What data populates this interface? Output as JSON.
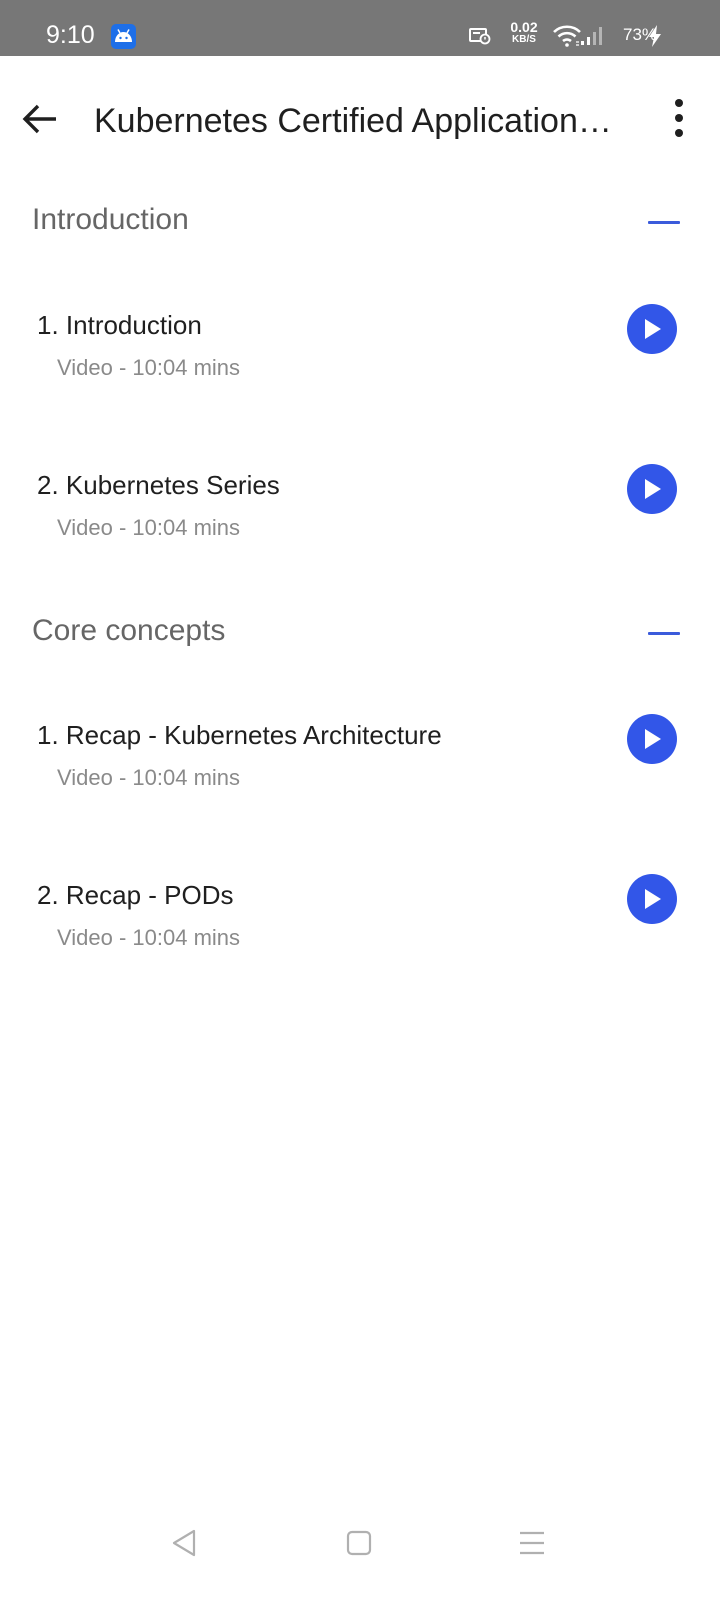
{
  "status_bar": {
    "time": "9:10",
    "net_speed_value": "0.02",
    "net_speed_unit": "KB/S",
    "battery": "73%"
  },
  "app_bar": {
    "title": "Kubernetes Certified Application Developer"
  },
  "sections": [
    {
      "title": "Introduction",
      "lessons": [
        {
          "title": "1. Introduction",
          "meta": "Video - 10:04 mins"
        },
        {
          "title": "2. Kubernetes Series",
          "meta": "Video - 10:04 mins"
        }
      ]
    },
    {
      "title": "Core concepts",
      "lessons": [
        {
          "title": "1. Recap - Kubernetes Architecture",
          "meta": "Video - 10:04 mins"
        },
        {
          "title": "2. Recap - PODs",
          "meta": "Video - 10:04 mins"
        }
      ]
    }
  ],
  "colors": {
    "accent": "#3256e8",
    "status_bar": "#777777",
    "secondary_text": "#8a8a8a"
  }
}
